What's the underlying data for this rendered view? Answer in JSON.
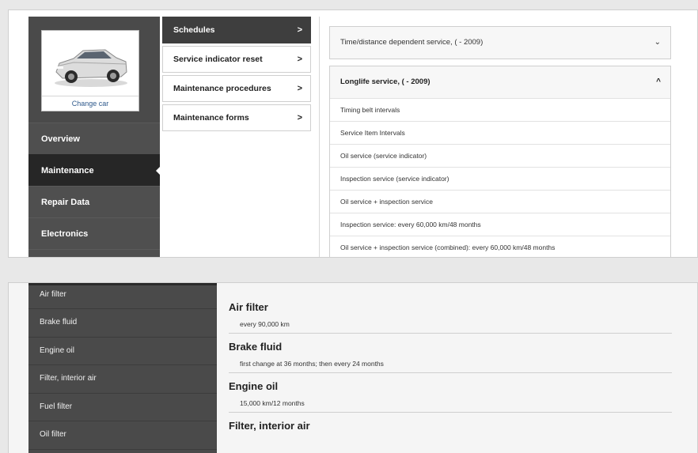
{
  "car": {
    "change_label": "Change car"
  },
  "nav": [
    {
      "label": "Overview"
    },
    {
      "label": "Maintenance"
    },
    {
      "label": "Repair Data"
    },
    {
      "label": "Electronics"
    }
  ],
  "menu": [
    {
      "label": "Schedules",
      "chevron": ">"
    },
    {
      "label": "Service indicator reset",
      "chevron": ">"
    },
    {
      "label": "Maintenance procedures",
      "chevron": ">"
    },
    {
      "label": "Maintenance forms",
      "chevron": ">"
    }
  ],
  "accordion1": {
    "title": "Time/distance dependent service, ( - 2009)",
    "chevron": "⌄"
  },
  "accordion2": {
    "title": "Longlife service, ( - 2009)",
    "chevron": "^",
    "rows": [
      "Timing belt intervals",
      "Service Item Intervals",
      "Oil service (service indicator)",
      "Inspection service (service indicator)",
      "Oil service + inspection service",
      "Inspection service: every 60,000 km/48 months",
      "Oil service + inspection service (combined): every 60,000 km/48 months"
    ]
  },
  "sidebar2": [
    "Air filter",
    "Brake fluid",
    "Engine oil",
    "Filter, interior air",
    "Fuel filter",
    "Oil filter"
  ],
  "sections": [
    {
      "title": "Air filter",
      "detail": "every 90,000 km"
    },
    {
      "title": "Brake fluid",
      "detail": "first change at 36 months; then every 24 months"
    },
    {
      "title": "Engine oil",
      "detail": "15,000 km/12 months"
    },
    {
      "title": "Filter, interior air",
      "detail": ""
    }
  ],
  "colors": {
    "nav_bg": "#4f4f4f",
    "nav_active": "#262626",
    "menu_active": "#3e3e3e",
    "link": "#2f5a8c"
  }
}
